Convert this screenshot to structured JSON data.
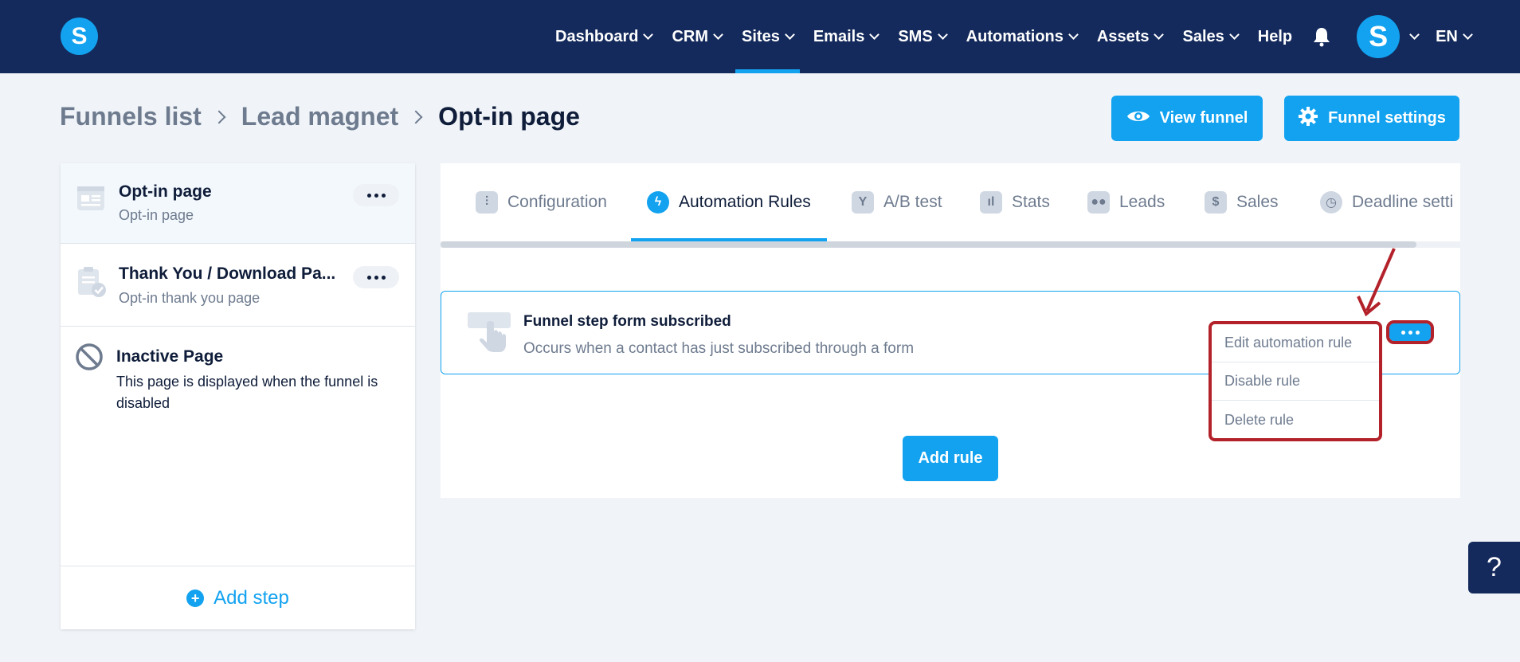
{
  "topbar": {
    "logo_letter": "S",
    "nav": [
      {
        "label": "Dashboard",
        "has_chevron": true,
        "active": false
      },
      {
        "label": "CRM",
        "has_chevron": true,
        "active": false
      },
      {
        "label": "Sites",
        "has_chevron": true,
        "active": true
      },
      {
        "label": "Emails",
        "has_chevron": true,
        "active": false
      },
      {
        "label": "SMS",
        "has_chevron": true,
        "active": false
      },
      {
        "label": "Automations",
        "has_chevron": true,
        "active": false
      },
      {
        "label": "Assets",
        "has_chevron": true,
        "active": false
      },
      {
        "label": "Sales",
        "has_chevron": true,
        "active": false
      },
      {
        "label": "Help",
        "has_chevron": false,
        "active": false
      }
    ],
    "avatar_letter": "S",
    "language": "EN",
    "colors": {
      "bg": "#142a5c",
      "accent": "#12a2f0"
    }
  },
  "breadcrumb": {
    "items": [
      "Funnels list",
      "Lead magnet"
    ],
    "current": "Opt-in page"
  },
  "actions": {
    "view_funnel": "View funnel",
    "funnel_settings": "Funnel settings"
  },
  "steps": [
    {
      "title": "Opt-in page",
      "subtitle": "Opt-in page",
      "selected": true
    },
    {
      "title": "Thank You / Download Pa...",
      "subtitle": "Opt-in thank you page",
      "selected": false
    },
    {
      "title": "Inactive Page",
      "subtitle": "This page is displayed when the funnel is disabled",
      "selected": false
    }
  ],
  "add_step": "Add step",
  "tabs": [
    {
      "label": "Configuration",
      "icon": "sliders-icon"
    },
    {
      "label": "Automation Rules",
      "icon": "lightning-icon",
      "active": true
    },
    {
      "label": "A/B test",
      "icon": "split-icon"
    },
    {
      "label": "Stats",
      "icon": "bar-chart-icon"
    },
    {
      "label": "Leads",
      "icon": "users-icon"
    },
    {
      "label": "Sales",
      "icon": "dollar-icon"
    },
    {
      "label": "Deadline setti",
      "icon": "clock-icon"
    }
  ],
  "rule": {
    "title": "Funnel step form subscribed",
    "description": "Occurs when a contact has just subscribed through a form"
  },
  "rule_menu": [
    "Edit automation rule",
    "Disable rule",
    "Delete rule"
  ],
  "add_rule": "Add rule",
  "help_fab": "?"
}
